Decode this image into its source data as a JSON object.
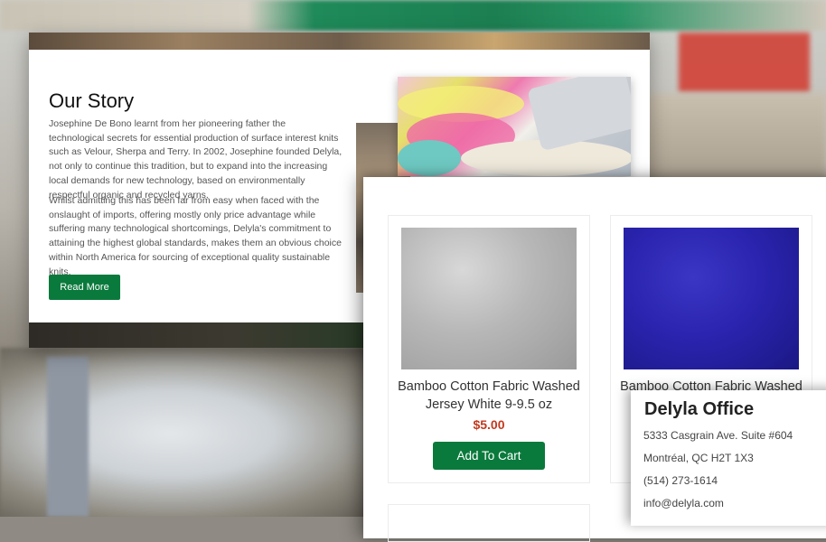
{
  "story": {
    "title": "Our Story",
    "paragraph1": "Josephine De Bono learnt from her pioneering father the technological secrets for essential production of surface interest knits such as  Velour, Sherpa and Terry. In 2002, Josephine founded Delyla, not only to continue this tradition, but to expand into the increasing local demands for new technology, based on environmentally respectful organic and recycled yarns.",
    "paragraph2": "Whilst admitting this has been far from easy when faced with the onslaught of imports, offering mostly only price advantage while suffering many technological shortcomings, Delyla's commitment to attaining the highest global standards, makes them an obvious choice within North America for sourcing of exceptional quality sustainable knits.",
    "read_more_label": "Read More"
  },
  "products": [
    {
      "name": "Bamboo Cotton Fabric Washed Jersey White 9-9.5 oz",
      "price": "$5.00",
      "cart_label": "Add To Cart",
      "swatch_color": "#b7b7b7"
    },
    {
      "name": "Bamboo Cotton Fabric Washed",
      "swatch_color": "#2a24b0"
    }
  ],
  "office": {
    "title": "Delyla Office",
    "address": "5333 Casgrain Ave. Suite #604",
    "city": "Montréal, QC H2T 1X3",
    "phone": "(514) 273-1614",
    "email": "info@delyla.com"
  },
  "colors": {
    "accent_green": "#0a7a3c",
    "price_red": "#c23a1f"
  }
}
